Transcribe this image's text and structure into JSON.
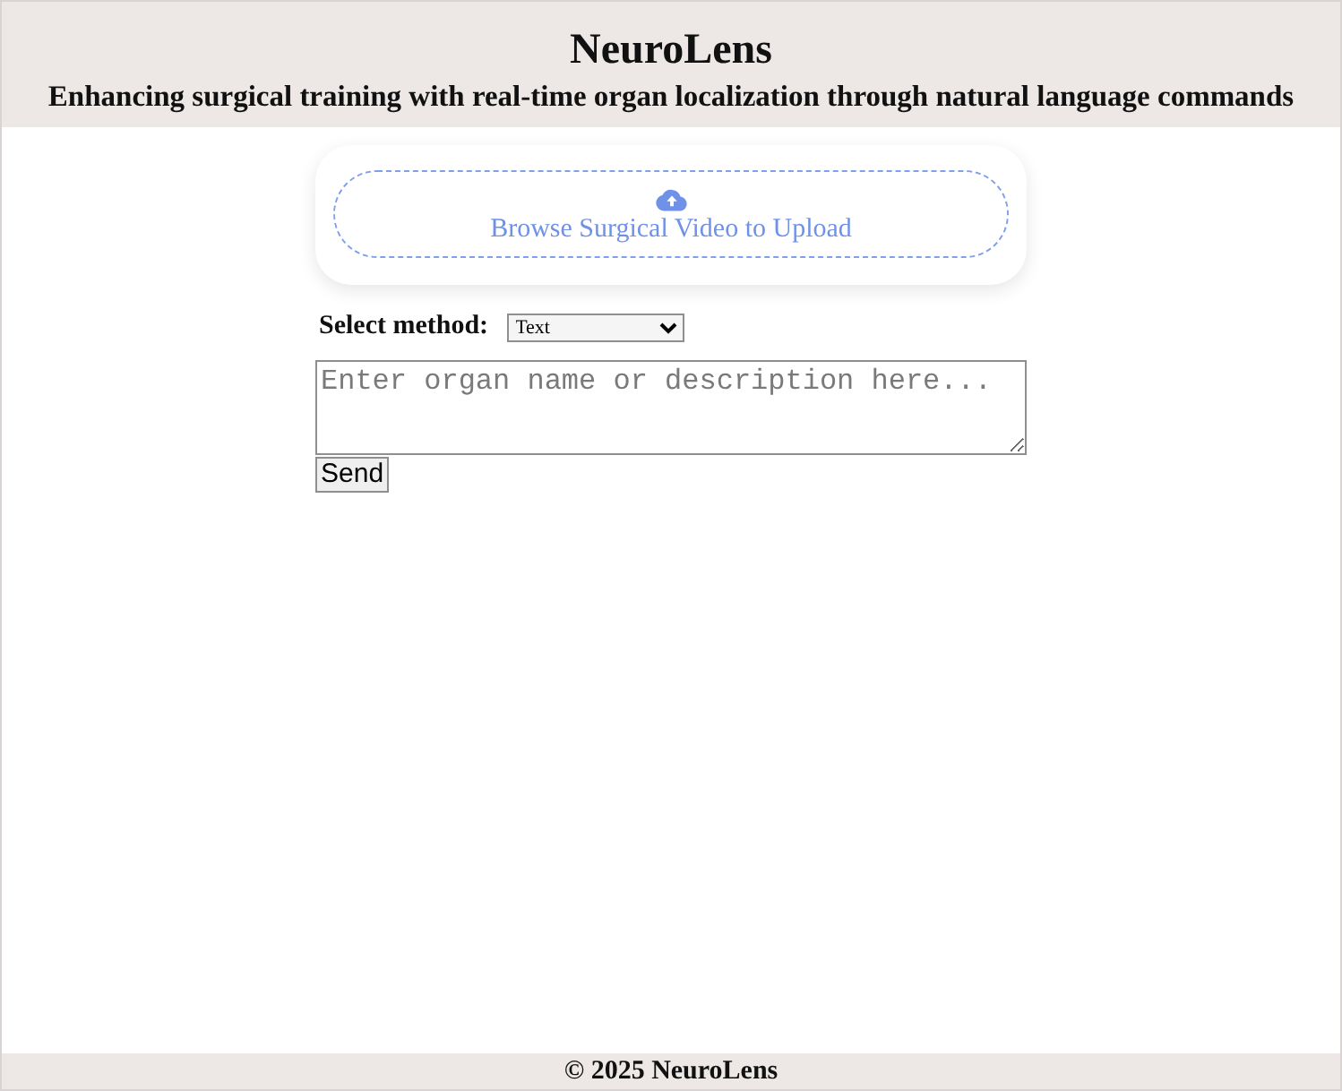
{
  "header": {
    "title": "NeuroLens",
    "subtitle": "Enhancing surgical training with real-time organ localization through natural language commands"
  },
  "upload": {
    "label": "Browse Surgical Video to Upload"
  },
  "method": {
    "label": "Select method:",
    "value": "Text"
  },
  "query": {
    "placeholder": "Enter organ name or description here..."
  },
  "send_button": {
    "label": "Send"
  },
  "footer": {
    "text": "© 2025 NeuroLens"
  }
}
